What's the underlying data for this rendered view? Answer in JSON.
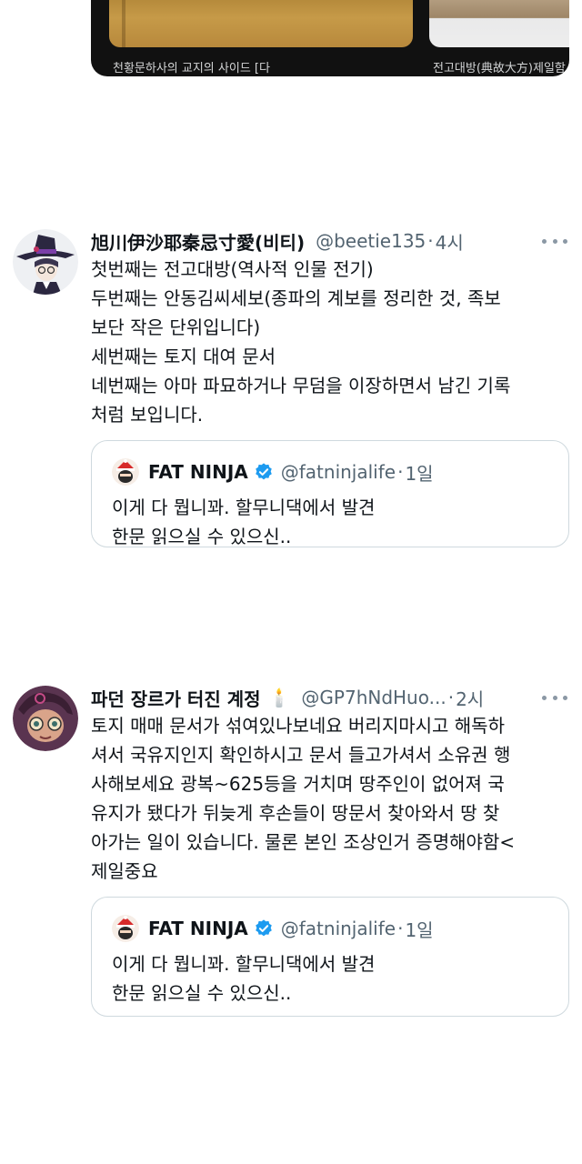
{
  "top_media": {
    "caption_left": "천황문하사의 교지의 사이드 [다",
    "caption_right": "전고대방(典故大方)제일함 - 고서"
  },
  "tweets": [
    {
      "name": "旭川伊沙耶秦忌寸愛(비티)",
      "handle": "@beetie135",
      "separator": "·",
      "time": "4시",
      "lines": [
        "첫번째는 전고대방(역사적 인물 전기)",
        "두번째는 안동김씨세보(종파의 계보를 정리한 것, 족보",
        "보단 작은 단위입니다)",
        "세번째는 토지 대여 문서",
        "네번째는 아마 파묘하거나 무덤을 이장하면서 남긴 기록",
        "처럼 보입니다."
      ],
      "quote": {
        "name": "FAT NINJA",
        "handle": "@fatninjalife",
        "separator": "·",
        "time": "1일",
        "lines": [
          "이게 다 뭡니꽈.  할무니댁에서 발견",
          "한문 읽으실 수 있으신.."
        ]
      }
    },
    {
      "name": "파던 장르가 터진 계정",
      "name_emoji": "🕯️",
      "handle": "@GP7hNdHuo...",
      "separator": "·",
      "time": "2시",
      "lines": [
        "토지 매매 문서가 섞여있나보네요 버리지마시고 해독하",
        "셔서 국유지인지 확인하시고 문서 들고가셔서 소유권 행",
        "사해보세요 광복~625등을 거치며 땅주인이 없어져 국",
        "유지가 됐다가 뒤늦게 후손들이 땅문서 찾아와서 땅 찾",
        "아가는 일이 있습니다. 물론 본인 조상인거 증명해야함<",
        "제일중요"
      ],
      "quote": {
        "name": "FAT NINJA",
        "handle": "@fatninjalife",
        "separator": "·",
        "time": "1일",
        "lines": [
          "이게 다 뭡니꽈.  할무니댁에서 발견",
          "한문 읽으실 수 있으신.."
        ]
      }
    }
  ],
  "colors": {
    "text": "#0f1419",
    "secondary": "#536471",
    "border": "#cfd9de",
    "verified": "#1d9bf0"
  },
  "icons": {
    "more": "more-icon",
    "verified": "verified-badge-icon"
  }
}
